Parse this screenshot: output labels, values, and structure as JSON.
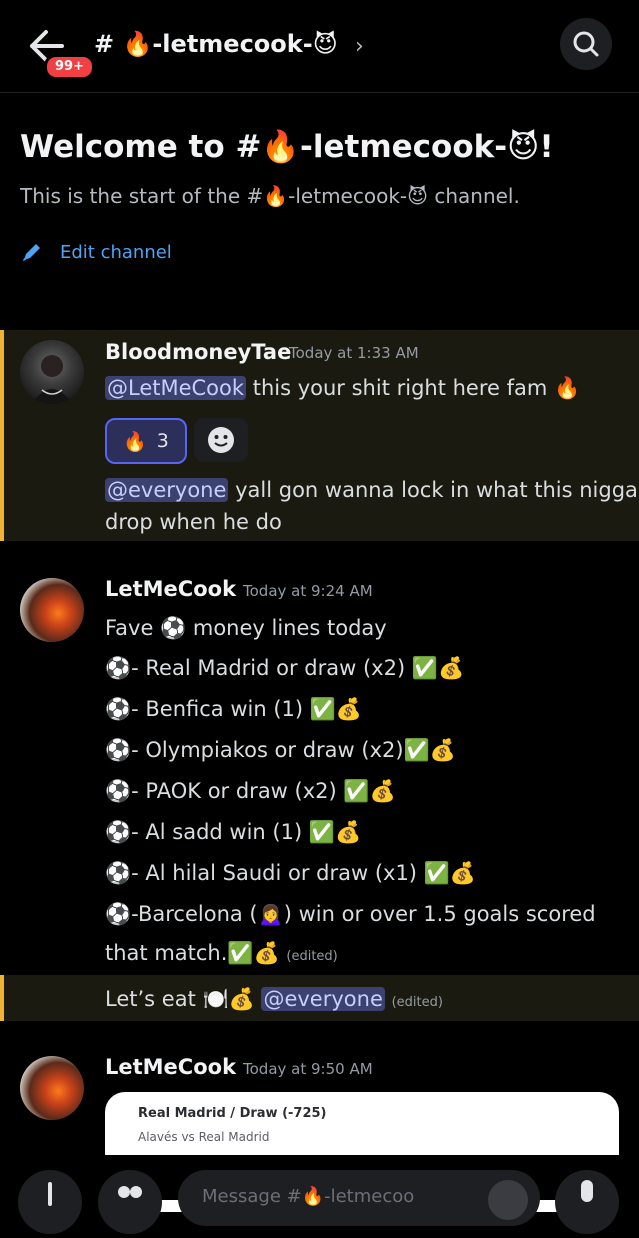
{
  "header": {
    "badge": "99+",
    "channel_title": "# 🔥-letmecook-😈",
    "chevron": "›"
  },
  "welcome": {
    "title": "Welcome to #🔥-letmecook-😈!",
    "subtitle": "This is the start of the #🔥-letmecook-😈 channel.",
    "edit_label": "Edit channel"
  },
  "messages": [
    {
      "author": "BloodmoneyTae",
      "timestamp": "Today at 1:33 AM",
      "line1_mention": "@LetMeCook",
      "line1_text": " this your shit right here fam 🔥",
      "reaction_emoji": "🔥",
      "reaction_count": "3",
      "line2_mention": "@everyone",
      "line2_text": " yall gon wanna lock in what this nigga",
      "line3_text": "drop when he do"
    },
    {
      "author": "LetMeCook",
      "timestamp": "Today at 9:24 AM",
      "lines": [
        "Fave ⚽ money lines today",
        "⚽- Real Madrid or draw (x2) ✅💰",
        "⚽- Benfica win (1) ✅💰",
        "⚽- Olympiakos or draw (x2)✅💰",
        "⚽- PAOK or draw (x2) ✅💰",
        "⚽- Al sadd win (1) ✅💰",
        "⚽- Al hilal Saudi or draw (x1) ✅💰",
        "⚽-Barcelona (🙍‍♀️) win or over 1.5 goals scored",
        "that match.✅💰"
      ],
      "edited_label": "(edited)",
      "followup_text": "Let’s eat 🍽️💰 ",
      "followup_mention": "@everyone",
      "followup_edited": "(edited)"
    },
    {
      "author": "LetMeCook",
      "timestamp": "Today at 9:50 AM",
      "embed_title": "Real Madrid / Draw (-725)",
      "embed_subtitle": "Alavés vs Real Madrid"
    }
  ],
  "composer": {
    "placeholder": "Message #🔥-letmecoo"
  },
  "colors": {
    "accent": "#5865f2",
    "mention_bg": "#3c4270",
    "highlight_bar": "#f0b232",
    "link": "#4ea3f5"
  }
}
